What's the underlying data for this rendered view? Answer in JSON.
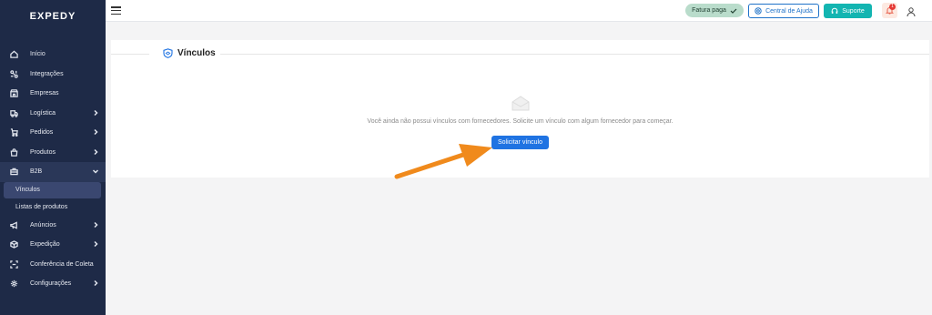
{
  "brand": {
    "logo_text": "EXPEDY"
  },
  "sidebar": {
    "items": [
      {
        "label": "Início",
        "icon": "home-icon",
        "chevron": false
      },
      {
        "label": "Integrações",
        "icon": "integrations-icon",
        "chevron": false
      },
      {
        "label": "Empresas",
        "icon": "store-icon",
        "chevron": false
      },
      {
        "label": "Logística",
        "icon": "truck-icon",
        "chevron": true
      },
      {
        "label": "Pedidos",
        "icon": "cart-icon",
        "chevron": true
      },
      {
        "label": "Produtos",
        "icon": "bag-icon",
        "chevron": true
      },
      {
        "label": "B2B",
        "icon": "b2b-icon",
        "chevron": true,
        "expanded": true
      }
    ],
    "subitems": [
      {
        "label": "Vínculos",
        "active": true
      },
      {
        "label": "Listas de produtos",
        "active": false
      }
    ],
    "items_after": [
      {
        "label": "Anúncios",
        "icon": "megaphone-icon",
        "chevron": true
      },
      {
        "label": "Expedição",
        "icon": "box-icon",
        "chevron": true
      },
      {
        "label": "Conferência de Coleta",
        "icon": "scan-icon",
        "chevron": false
      },
      {
        "label": "Configurações",
        "icon": "gear-icon",
        "chevron": true
      }
    ]
  },
  "topbar": {
    "fatura_label": "Fatura paga",
    "ajuda_label": "Central de Ajuda",
    "suporte_label": "Suporte",
    "notification_count": "1"
  },
  "main": {
    "title": "Vínculos",
    "empty_message": "Você ainda não possui vínculos com fornecedores. Solicite um vínculo com algum fornecedor para começar.",
    "primary_button": "Solicitar vínculo"
  },
  "colors": {
    "sidebar_bg": "#1e2a47",
    "accent_blue": "#1f73e2",
    "support_teal": "#13b5b1",
    "arrow_orange": "#f08a1c"
  }
}
